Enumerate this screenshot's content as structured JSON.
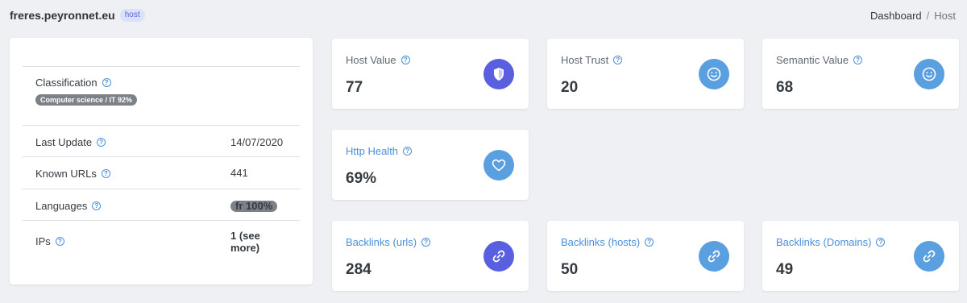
{
  "header": {
    "site": "freres.peyronnet.eu",
    "badge": "host",
    "breadcrumb": {
      "home": "Dashboard",
      "separator": "/",
      "current": "Host"
    }
  },
  "info": {
    "classification": {
      "label": "Classification",
      "value": "Computer science / IT 92%"
    },
    "last_update": {
      "label": "Last Update",
      "value": "14/07/2020"
    },
    "known_urls": {
      "label": "Known URLs",
      "value": "441"
    },
    "languages": {
      "label": "Languages",
      "value": "fr 100%"
    },
    "ips": {
      "label": "IPs",
      "value_line1": "1 (see",
      "value_line2": "more)"
    }
  },
  "metrics": {
    "host_value": {
      "title": "Host Value",
      "value": "77",
      "icon": "shield-icon",
      "color": "#5a5fe0"
    },
    "host_trust": {
      "title": "Host Trust",
      "value": "20",
      "icon": "smiley-icon",
      "color": "#5a9fe0"
    },
    "semantic_value": {
      "title": "Semantic Value",
      "value": "68",
      "icon": "smiley-icon",
      "color": "#5a9fe0"
    },
    "http_health": {
      "title": "Http Health",
      "value": "69%",
      "icon": "heart-icon",
      "color": "#5a9fe0"
    },
    "backlinks_urls": {
      "title": "Backlinks (urls)",
      "value": "284",
      "icon": "link-icon",
      "color": "#5a5fe0"
    },
    "backlinks_hosts": {
      "title": "Backlinks (hosts)",
      "value": "50",
      "icon": "link-icon",
      "color": "#5a9fe0"
    },
    "backlinks_domains": {
      "title": "Backlinks (Domains)",
      "value": "49",
      "icon": "link-icon",
      "color": "#5a9fe0"
    }
  },
  "help_glyph": "?"
}
